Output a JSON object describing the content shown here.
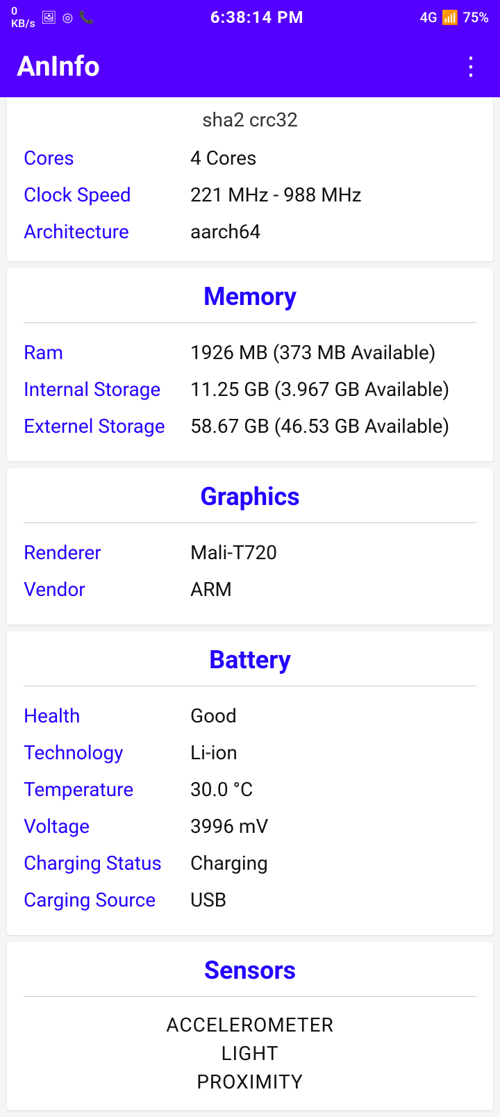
{
  "statusBar": {
    "left": {
      "kbps": "0\nKB/s",
      "icons": [
        "📷",
        "🎯",
        "📞"
      ]
    },
    "time": "6:38:14 PM",
    "right": {
      "network": "4G",
      "battery": "75%"
    }
  },
  "appBar": {
    "title": "AnInfo",
    "menuIcon": "⋮"
  },
  "topPartial": {
    "sha": "sha2 crc32",
    "rows": [
      {
        "label": "Cores",
        "value": "4 Cores"
      },
      {
        "label": "Clock Speed",
        "value": "221 MHz - 988 MHz"
      },
      {
        "label": "Architecture",
        "value": "aarch64"
      }
    ]
  },
  "memory": {
    "title": "Memory",
    "rows": [
      {
        "label": "Ram",
        "value": "1926 MB (373 MB Available)"
      },
      {
        "label": "Internal Storage",
        "value": "11.25 GB (3.967 GB Available)"
      },
      {
        "label": "Externel Storage",
        "value": "58.67 GB (46.53 GB Available)"
      }
    ]
  },
  "graphics": {
    "title": "Graphics",
    "rows": [
      {
        "label": "Renderer",
        "value": "Mali-T720"
      },
      {
        "label": "Vendor",
        "value": "ARM"
      }
    ]
  },
  "battery": {
    "title": "Battery",
    "rows": [
      {
        "label": "Health",
        "value": "Good"
      },
      {
        "label": "Technology",
        "value": "Li-ion"
      },
      {
        "label": "Temperature",
        "value": "30.0 °C"
      },
      {
        "label": "Voltage",
        "value": "3996 mV"
      },
      {
        "label": "Charging Status",
        "value": "Charging"
      },
      {
        "label": "Carging Source",
        "value": "USB"
      }
    ]
  },
  "sensors": {
    "title": "Sensors",
    "items": [
      "ACCELEROMETER",
      "LIGHT",
      "PROXIMITY"
    ]
  }
}
